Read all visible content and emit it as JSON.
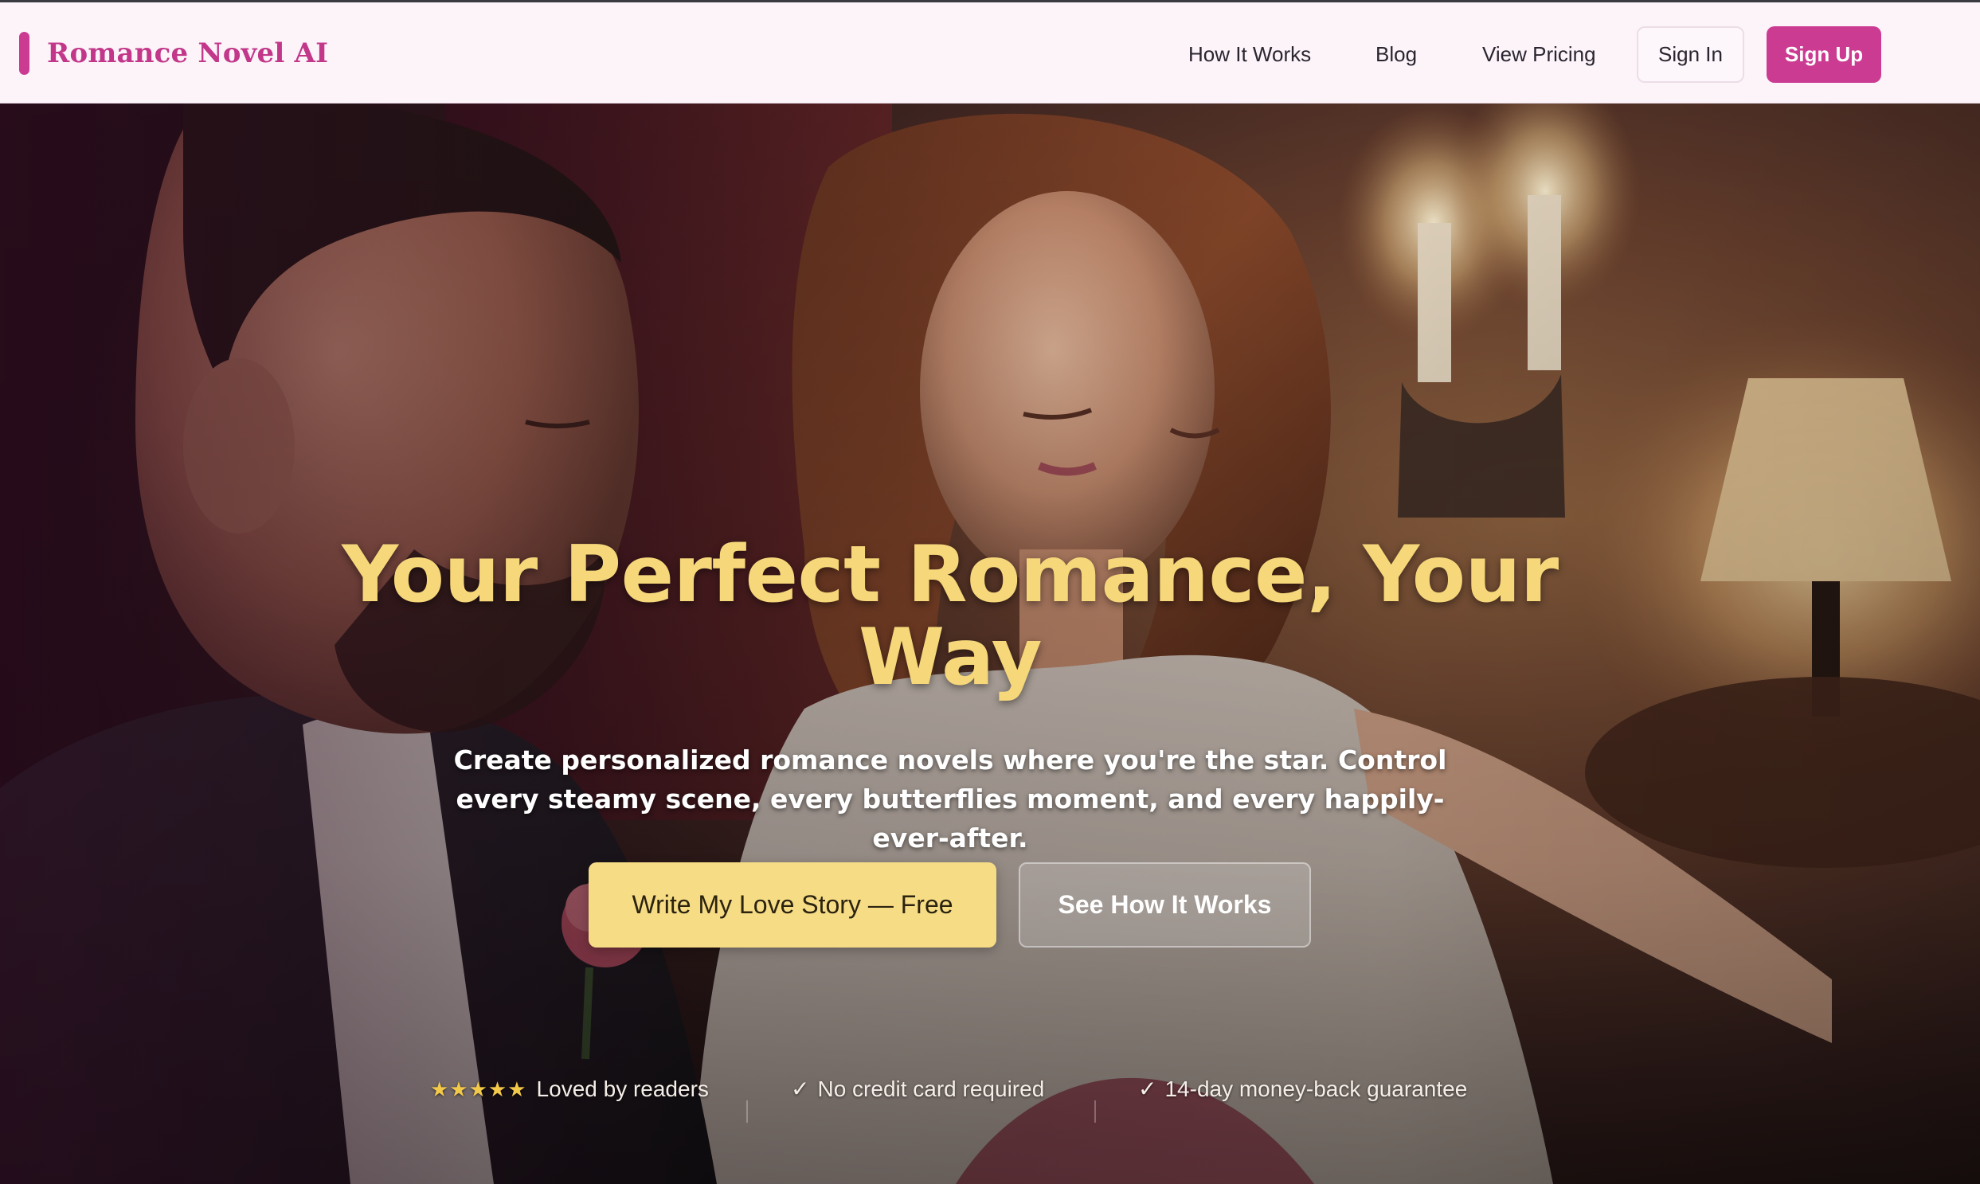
{
  "brand": {
    "name": "Romance Novel AI",
    "accent_color": "#cc3b92"
  },
  "nav": {
    "links": [
      "How It Works",
      "Blog",
      "View Pricing"
    ],
    "sign_in": "Sign In",
    "sign_up": "Sign Up"
  },
  "hero": {
    "headline": "Your Perfect Romance, Your Way",
    "subhead": "Create personalized romance novels where you're the star. Control every steamy scene, every butterflies moment, and every happily-ever-after.",
    "cta_primary": "Write My Love Story — Free",
    "cta_secondary": "See How It Works",
    "headline_color": "#f6d77a",
    "cta_primary_color": "#f6dc85"
  },
  "trust": {
    "stars": "★★★★★",
    "rating_text": "Loved by readers",
    "check_symbol": "✓",
    "no_card": "No credit card required",
    "guarantee": "14-day money-back guarantee"
  }
}
